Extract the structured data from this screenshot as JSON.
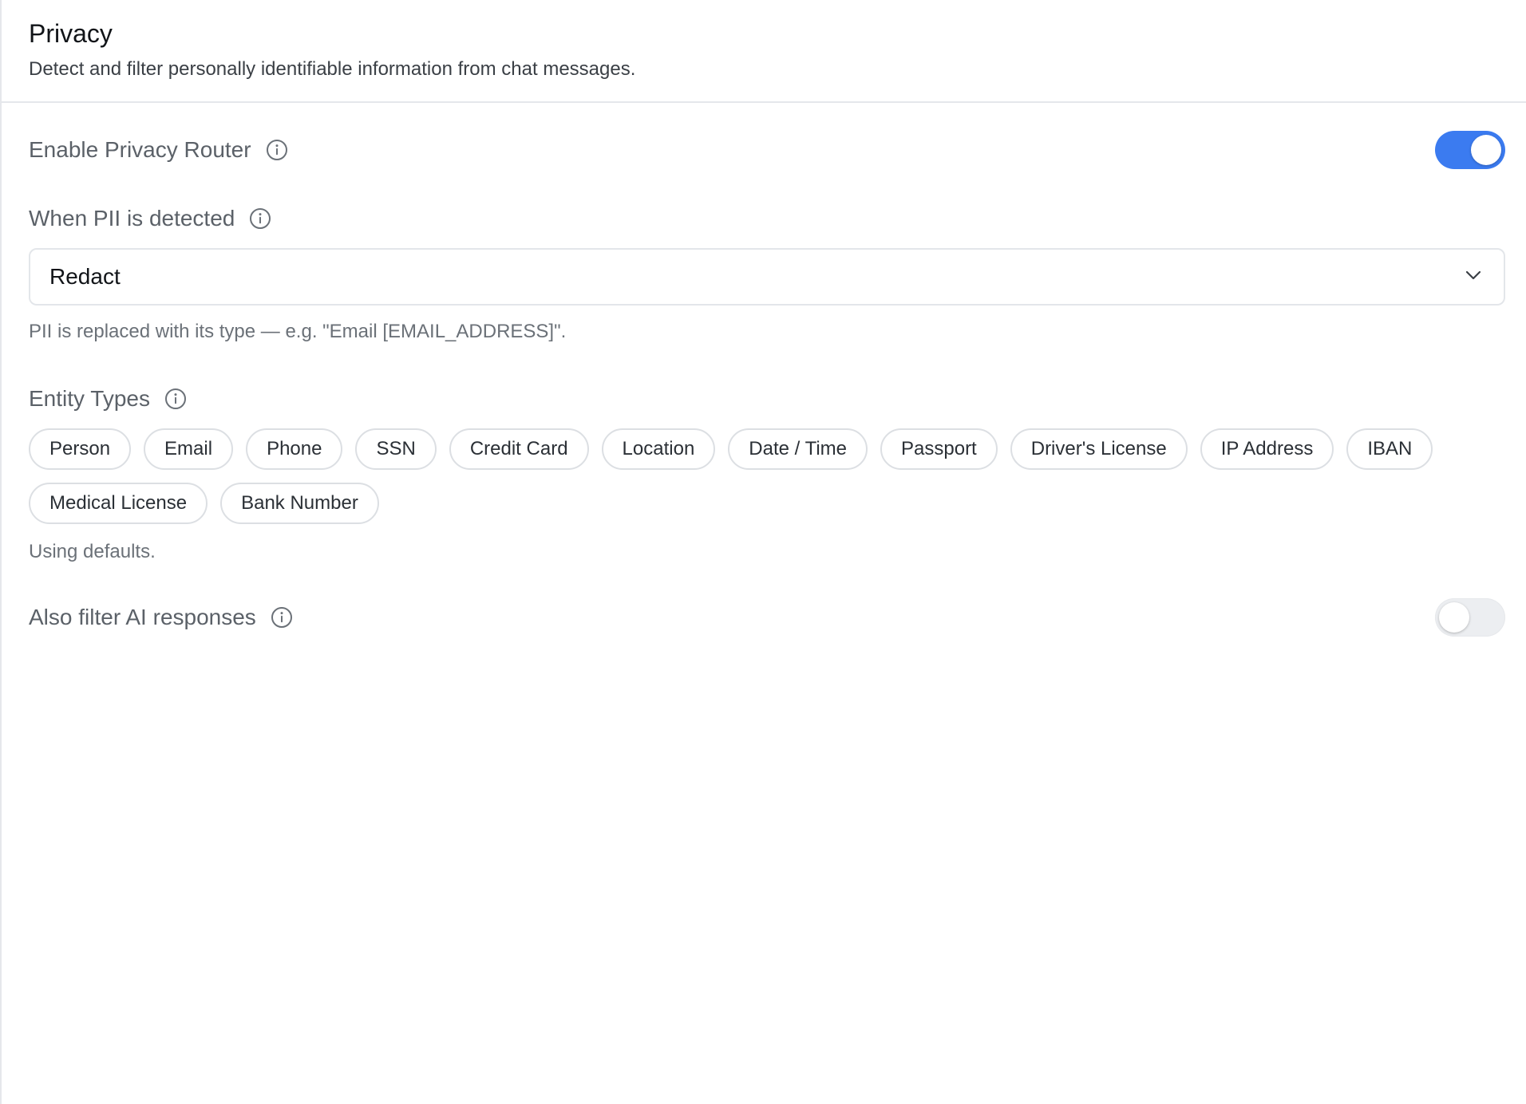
{
  "header": {
    "title": "Privacy",
    "subtitle": "Detect and filter personally identifiable information from chat messages."
  },
  "privacy_router": {
    "label": "Enable Privacy Router",
    "enabled": true
  },
  "pii_action": {
    "label": "When PII is detected",
    "selected": "Redact",
    "help": "PII is replaced with its type — e.g. \"Email [EMAIL_ADDRESS]\"."
  },
  "entity_types": {
    "label": "Entity Types",
    "items": [
      "Person",
      "Email",
      "Phone",
      "SSN",
      "Credit Card",
      "Location",
      "Date / Time",
      "Passport",
      "Driver's License",
      "IP Address",
      "IBAN",
      "Medical License",
      "Bank Number"
    ],
    "help": "Using defaults."
  },
  "ai_responses": {
    "label": "Also filter AI responses",
    "enabled": false
  },
  "colors": {
    "toggle_on": "#3b7bf0",
    "toggle_off": "#eceef1",
    "border": "#e5e7eb"
  },
  "icons": {
    "info": "info-circle-icon",
    "dropdown": "chevron-down-icon"
  }
}
